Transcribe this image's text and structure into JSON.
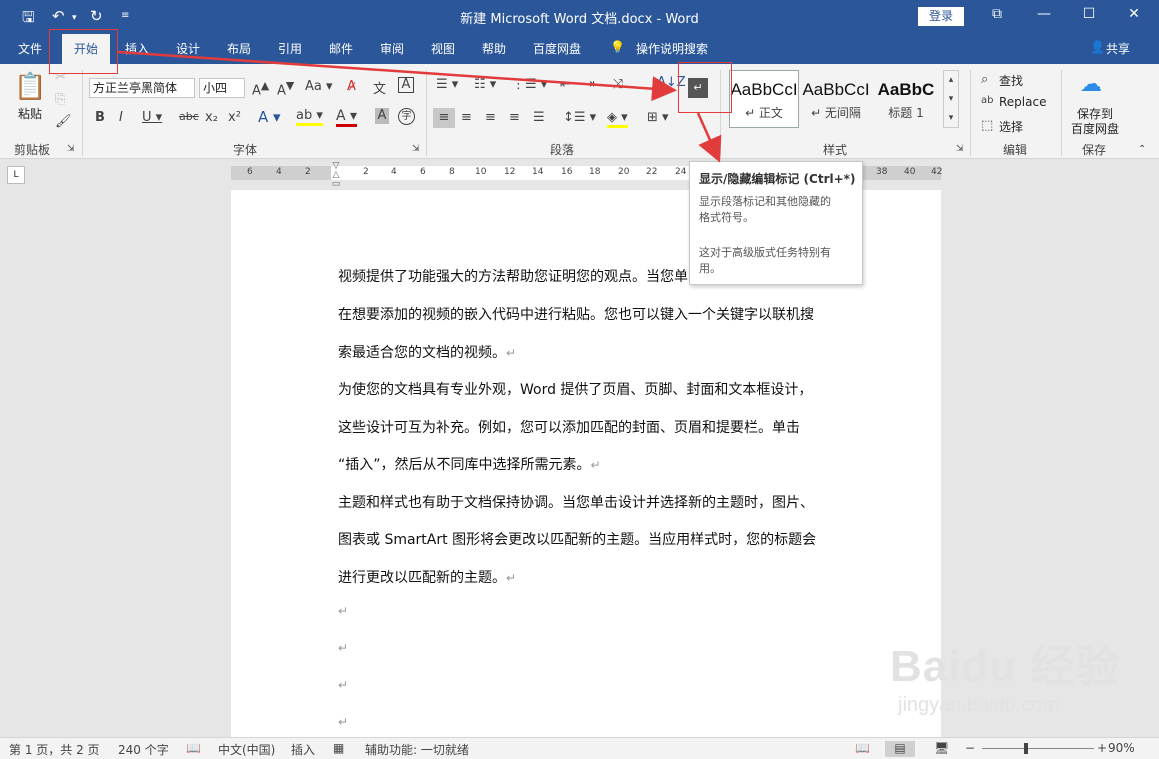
{
  "window": {
    "title": "新建 Microsoft Word 文档.docx  -  Word",
    "login": "登录",
    "share": "共享"
  },
  "tabs": [
    "文件",
    "开始",
    "插入",
    "设计",
    "布局",
    "引用",
    "邮件",
    "审阅",
    "视图",
    "帮助",
    "百度网盘"
  ],
  "tell_me": "操作说明搜索",
  "ribbon": {
    "clipboard": {
      "paste": "粘贴",
      "label": "剪贴板"
    },
    "font": {
      "name": "方正兰亭黑简体",
      "size": "小四",
      "label": "字体"
    },
    "paragraph": {
      "label": "段落"
    },
    "styles": {
      "label": "样式",
      "items": [
        {
          "sample": "AaBbCcI",
          "name": "↵ 正文"
        },
        {
          "sample": "AaBbCcI",
          "name": "↵ 无间隔"
        },
        {
          "sample": "AaBbC",
          "name": "标题 1"
        }
      ]
    },
    "editing": {
      "find": "查找",
      "replace": "Replace",
      "select": "选择",
      "label": "编辑"
    },
    "save": {
      "line1": "保存到",
      "line2": "百度网盘",
      "label": "保存"
    }
  },
  "ruler": {
    "left": [
      "6",
      "4",
      "2"
    ],
    "right": [
      "2",
      "4",
      "6",
      "8",
      "10",
      "12",
      "14",
      "16",
      "18",
      "20",
      "22",
      "24",
      "26"
    ],
    "far": [
      "38",
      "40",
      "42"
    ]
  },
  "tooltip": {
    "title": "显示/隐藏编辑标记 (Ctrl+*)",
    "desc1": "显示段落标记和其他隐藏的",
    "desc2": "格式符号。",
    "desc3": "这对于高级版式任务特别有",
    "desc4": "用。"
  },
  "document": {
    "lines": [
      "视频提供了功能强大的方法帮助您证明您的观点。当您单",
      "在想要添加的视频的嵌入代码中进行粘贴。您也可以键入一个关键字以联机搜",
      "索最适合您的文档的视频。",
      "为使您的文档具有专业外观，Word 提供了页眉、页脚、封面和文本框设计，",
      "这些设计可互为补充。例如，您可以添加匹配的封面、页眉和提要栏。单击",
      "“插入”，然后从不同库中选择所需元素。",
      "主题和样式也有助于文档保持协调。当您单击设计并选择新的主题时，图片、",
      "图表或 SmartArt 图形将会更改以匹配新的主题。当应用样式时，您的标题会",
      "进行更改以匹配新的主题。"
    ],
    "paragraph_mark": "↵"
  },
  "status": {
    "pages": "第 1 页，共 2 页",
    "words": "240 个字",
    "lang": "中文(中国)",
    "mode": "插入",
    "accessibility": "辅助功能: 一切就绪",
    "zoom": "90%"
  },
  "watermark": {
    "brand": "Baidu 经验",
    "url": "jingyan.baidu.com"
  },
  "colors": {
    "title_bar": "#2b579a",
    "annotation": "#e23b3b"
  }
}
